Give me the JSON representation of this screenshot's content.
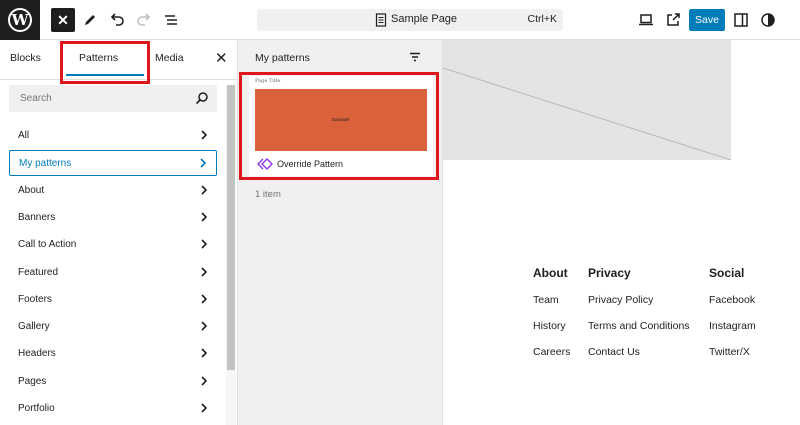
{
  "toolbar": {
    "close_label": "✕",
    "document_title": "Sample Page",
    "shortcut": "Ctrl+K",
    "save_label": "Save"
  },
  "inserter": {
    "tabs": [
      {
        "label": "Blocks"
      },
      {
        "label": "Patterns"
      },
      {
        "label": "Media"
      }
    ],
    "active_tab": "Patterns",
    "close_label": "✕",
    "search_placeholder": "Search",
    "categories": [
      {
        "label": "All"
      },
      {
        "label": "My patterns"
      },
      {
        "label": "About"
      },
      {
        "label": "Banners"
      },
      {
        "label": "Call to Action"
      },
      {
        "label": "Featured"
      },
      {
        "label": "Footers"
      },
      {
        "label": "Gallery"
      },
      {
        "label": "Headers"
      },
      {
        "label": "Pages"
      },
      {
        "label": "Portfolio"
      }
    ],
    "active_category": "My patterns"
  },
  "patterns_panel": {
    "heading": "My patterns",
    "card": {
      "preview_title": "Page Title",
      "preview_text": "Example",
      "name": "Override Pattern",
      "preview_color": "#da6139"
    },
    "count": "1 item"
  },
  "footer": {
    "columns": [
      {
        "title": "About",
        "links": [
          "Team",
          "History",
          "Careers"
        ]
      },
      {
        "title": "Privacy",
        "links": [
          "Privacy Policy",
          "Terms and Conditions",
          "Contact Us"
        ]
      },
      {
        "title": "Social",
        "links": [
          "Facebook",
          "Instagram",
          "Twitter/X"
        ]
      }
    ]
  },
  "colors": {
    "accent": "#007cba",
    "highlight": "#e0161d",
    "dark": "#1e1e1e"
  }
}
